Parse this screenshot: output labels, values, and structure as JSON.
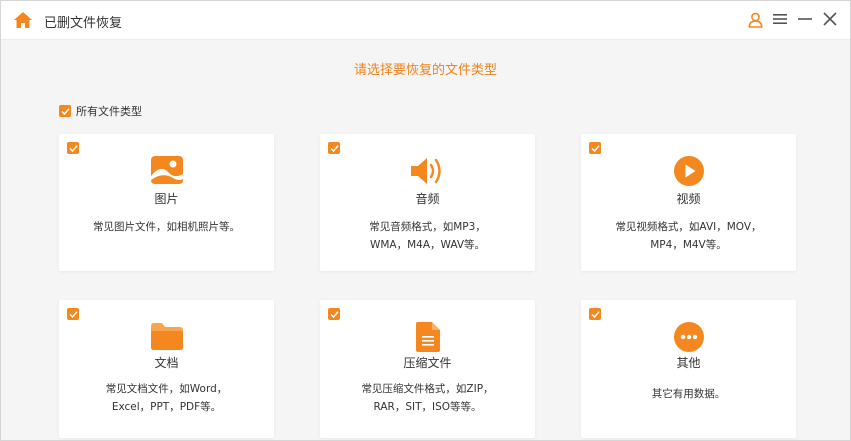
{
  "window": {
    "title": "已删文件恢复"
  },
  "heading": "请选择要恢复的文件类型",
  "select_all": {
    "label": "所有文件类型",
    "checked": true
  },
  "accent_color": "#f5871f",
  "cards": [
    {
      "name": "图片",
      "desc_line1": "常见图片文件，如相机照片等。",
      "desc_line2": "",
      "icon": "image-icon",
      "checked": true
    },
    {
      "name": "音频",
      "desc_line1": "常见音频格式，如MP3，",
      "desc_line2": "WMA，M4A，WAV等。",
      "icon": "speaker-icon",
      "checked": true
    },
    {
      "name": "视频",
      "desc_line1": "常见视频格式，如AVI，MOV，",
      "desc_line2": "MP4，M4V等。",
      "icon": "play-icon",
      "checked": true
    },
    {
      "name": "文档",
      "desc_line1": "常见文档文件，如Word，",
      "desc_line2": "Excel，PPT，PDF等。",
      "icon": "folder-icon",
      "checked": true
    },
    {
      "name": "压缩文件",
      "desc_line1": "常见压缩文件格式，如ZIP，",
      "desc_line2": "RAR，SIT，ISO等等。",
      "icon": "archive-icon",
      "checked": true
    },
    {
      "name": "其他",
      "desc_line1": "其它有用数据。",
      "desc_line2": "",
      "icon": "more-icon",
      "checked": true
    }
  ]
}
